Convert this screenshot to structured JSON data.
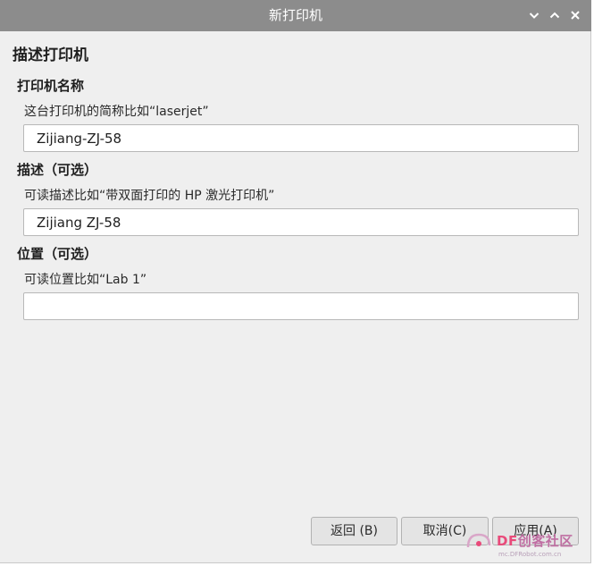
{
  "window": {
    "title": "新打印机"
  },
  "titlebar_icons": [
    "chevron-down-icon",
    "chevron-up-icon",
    "close-icon"
  ],
  "form": {
    "heading": "描述打印机",
    "name": {
      "label": "打印机名称",
      "hint": "这台打印机的简称比如“laserjet”",
      "value": "Zijiang-ZJ-58"
    },
    "description": {
      "label": "描述（可选）",
      "hint": "可读描述比如“带双面打印的 HP 激光打印机”",
      "value": "Zijiang ZJ-58"
    },
    "location": {
      "label": "位置（可选）",
      "hint": "可读位置比如“Lab 1”",
      "value": ""
    }
  },
  "buttons": {
    "back": "返回 (B)",
    "cancel": "取消(C)",
    "apply": "应用(A)"
  },
  "watermark": {
    "brand_de": "DF",
    "brand_rest": "创客社区",
    "url": "mc.DFRobot.com.cn"
  },
  "colors": {
    "titlebar": "#8c8c8c",
    "window_bg": "#efefef",
    "field_bg": "#ffffff",
    "button_bg": "#e4e4e4"
  }
}
